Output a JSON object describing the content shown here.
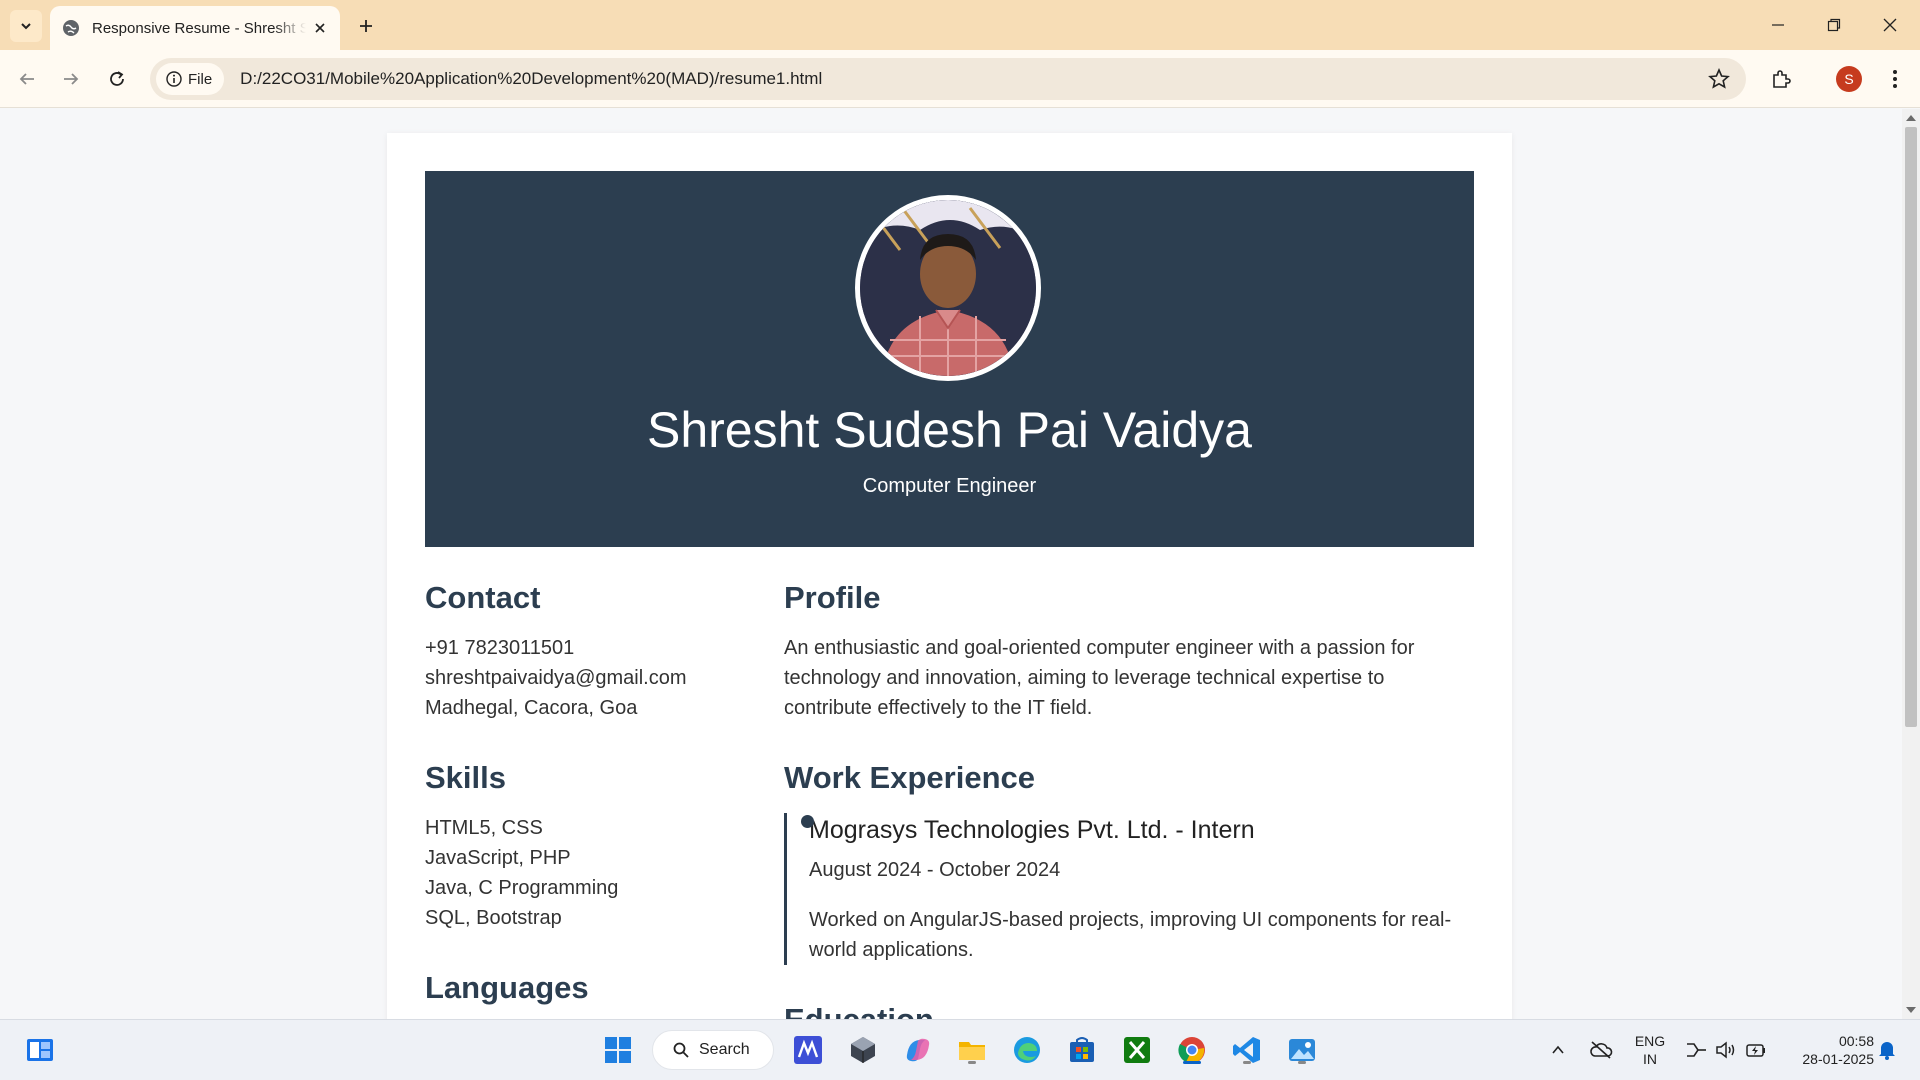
{
  "browser": {
    "tab_title": "Responsive Resume - Shresht Sudesh Pai Vaidya",
    "address_chip": "File",
    "url": "D:/22CO31/Mobile%20Application%20Development%20(MAD)/resume1.html",
    "profile_initial": "S"
  },
  "resume": {
    "name": "Shresht Sudesh Pai Vaidya",
    "role": "Computer Engineer",
    "contact": {
      "heading": "Contact",
      "phone": "+91 7823011501",
      "email": "shreshtpaivaidya@gmail.com",
      "address": "Madhegal, Cacora, Goa"
    },
    "skills": {
      "heading": "Skills",
      "items": [
        "HTML5, CSS",
        "JavaScript, PHP",
        "Java, C Programming",
        "SQL, Bootstrap"
      ]
    },
    "languages": {
      "heading": "Languages"
    },
    "profile": {
      "heading": "Profile",
      "text": "An enthusiastic and goal-oriented computer engineer with a passion for technology and innovation, aiming to leverage technical expertise to contribute effectively to the IT field."
    },
    "experience": {
      "heading": "Work Experience",
      "jobs": [
        {
          "title": "Mograsys Technologies Pvt. Ltd. - Intern",
          "dates": "August 2024 - October 2024",
          "description": "Worked on AngularJS-based projects, improving UI components for real-world applications."
        }
      ]
    },
    "education": {
      "heading": "Education"
    }
  },
  "taskbar": {
    "search_label": "Search",
    "language_line1": "ENG",
    "language_line2": "IN",
    "time": "00:58",
    "date": "28-01-2025"
  },
  "colors": {
    "tabbar": "#f7ddb6",
    "hero": "#2c3e50",
    "heading": "#2c3e50",
    "profile_badge": "#c63b1e"
  }
}
